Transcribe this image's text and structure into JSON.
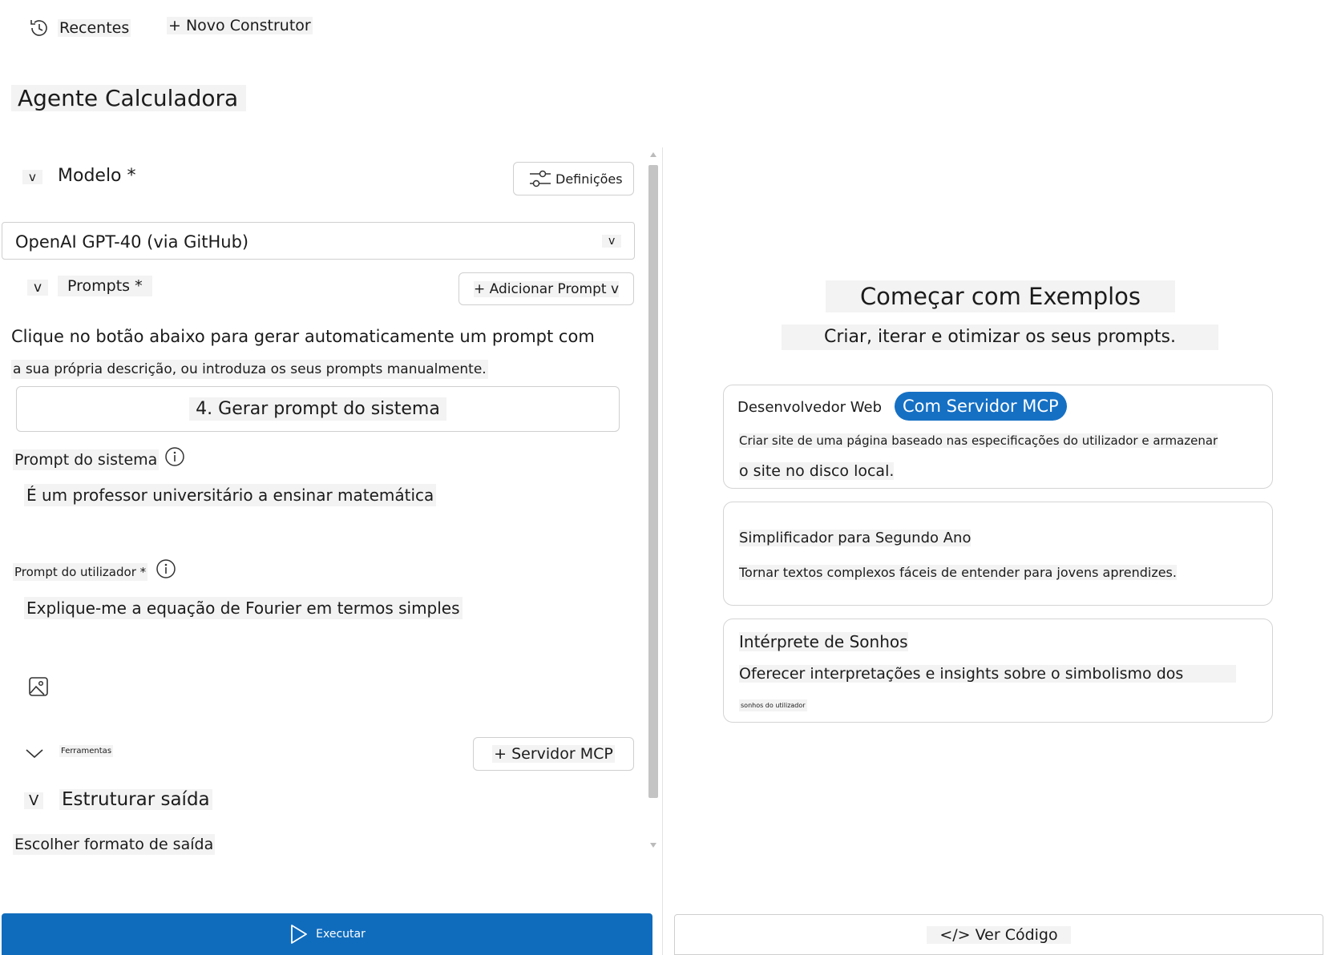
{
  "topbar": {
    "recent_label": "Recentes",
    "new_builder_label": "+ Novo Construtor"
  },
  "agent": {
    "title": "Agente Calculadora"
  },
  "model": {
    "toggle": "v",
    "label": "Modelo *",
    "settings_label": "Definições",
    "selected": "OpenAI GPT-40 (via GitHub)",
    "dropdown_glyph": "v"
  },
  "prompts": {
    "toggle": "v",
    "label": "Prompts *",
    "add_label": "+ Adicionar Prompt v",
    "help_line1": "Clique no botão abaixo para gerar automaticamente um prompt com",
    "help_line2": "a sua própria descrição, ou introduza os seus prompts manualmente.",
    "generate_label": "4. Gerar prompt do sistema",
    "system_label": "Prompt do sistema",
    "system_value": "É um professor universitário a ensinar matemática",
    "user_label": "Prompt do utilizador *",
    "user_value": "Explique-me a equação de Fourier em termos simples"
  },
  "tools": {
    "label": "Ferramentas",
    "add_mcp_label": "+ Servidor MCP"
  },
  "output": {
    "toggle": "V",
    "label": "Estruturar saída",
    "format_placeholder": "Escolher formato de saída"
  },
  "run": {
    "label": "Executar"
  },
  "examples": {
    "title": "Começar com Exemplos",
    "subtitle": "Criar, iterar e otimizar os seus prompts.",
    "cards": [
      {
        "title": "Desenvolvedor Web",
        "badge": "Com Servidor MCP",
        "desc_line1": "Criar site de uma página baseado nas especificações do utilizador e armazenar",
        "desc_line2": "o site no disco local."
      },
      {
        "title": "Simplificador para Segundo Ano",
        "desc_line1": "Tornar textos complexos fáceis de entender para jovens aprendizes."
      },
      {
        "title": "Intérprete de Sonhos",
        "desc_line1": "Oferecer interpretações e insights sobre o simbolismo dos",
        "desc_line2": "sonhos do utilizador"
      }
    ]
  },
  "footer": {
    "view_code_label": "</> Ver Código"
  },
  "colors": {
    "accent": "#0f6cbd",
    "badge": "#1570c4"
  }
}
